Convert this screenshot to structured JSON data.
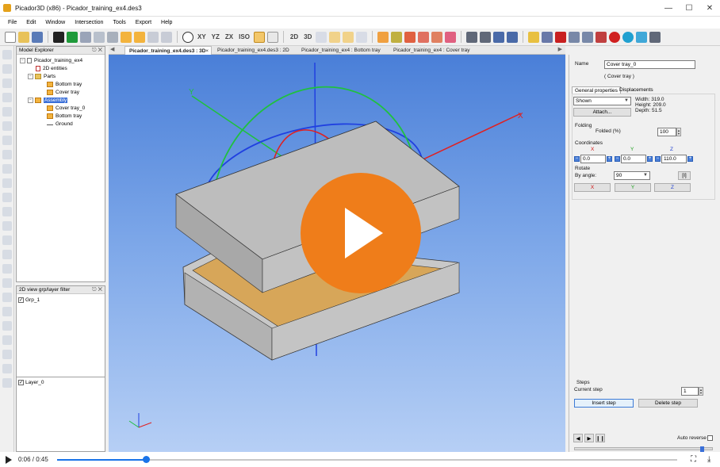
{
  "window": {
    "title": "Picador3D (x86) - Picador_training_ex4.des3",
    "controls": [
      "minimize-icon",
      "maximize-icon",
      "close-icon"
    ]
  },
  "menu": [
    "File",
    "Edit",
    "Window",
    "Intersection",
    "Tools",
    "Export",
    "Help"
  ],
  "toolbar": {
    "view_labels": {
      "xy": "XY",
      "yz": "YZ",
      "zx": "ZX",
      "iso": "ISO",
      "two_d": "2D",
      "three_d": "3D"
    }
  },
  "model_explorer": {
    "title": "Model Explorer",
    "root": "Picador_training_ex4",
    "entities": "2D entities",
    "parts_folder": "Parts",
    "parts": [
      "Bottom tray",
      "Cover tray"
    ],
    "assembly": "Assembly",
    "assembly_items": [
      "Cover tray_0",
      "Bottom tray",
      "Ground"
    ]
  },
  "layer_filter": {
    "title": "2D view grp/layer filter",
    "group": "Grp_1",
    "layer": "Layer_0"
  },
  "tabs": [
    "Picador_training_ex4.des3 : 3D",
    "Picador_training_ex4.des3 : 2D",
    "Picador_training_ex4 : Bottom tray",
    "Picador_training_ex4 : Cover tray"
  ],
  "viewport": {
    "axis_labels": {
      "x": "X",
      "y": "Y"
    },
    "colors": {
      "play": "#ef7d1a",
      "x_axis": "#e02020",
      "y_axis": "#20c040",
      "z_axis": "#2040e0"
    }
  },
  "properties": {
    "name_label": "Name",
    "name_value": "Cover tray_0",
    "subtitle": "( Cover tray )",
    "tab_general": "General properties",
    "tab_displacements": "Displacements",
    "visibility": "Shown",
    "attach_button": "Attach...",
    "width": "Width: 319.0",
    "height": "Height: 209.0",
    "depth": "Depth: 51.5",
    "folding_label": "Folding",
    "folded_label": "Folded (%)",
    "folded_value": "100",
    "coordinates_label": "Coordinates",
    "axis_x": "X",
    "axis_y": "Y",
    "axis_z": "Z",
    "coord_x": "0.0",
    "coord_y": "0.0",
    "coord_z": "110.0",
    "rotate_label": "Rotate",
    "by_angle_label": "By angle:",
    "angle_value": "90",
    "angle_bracket": "[I]",
    "rot_x": "X",
    "rot_y": "Y",
    "rot_z": "Z",
    "steps_label": "Steps",
    "current_step_label": "Current step",
    "current_step_value": "1",
    "insert_step": "Insert step",
    "delete_step": "Delete step",
    "auto_reverse": "Auto reverse"
  },
  "video": {
    "time": "0:06 / 0:45",
    "progress": 0.143
  }
}
